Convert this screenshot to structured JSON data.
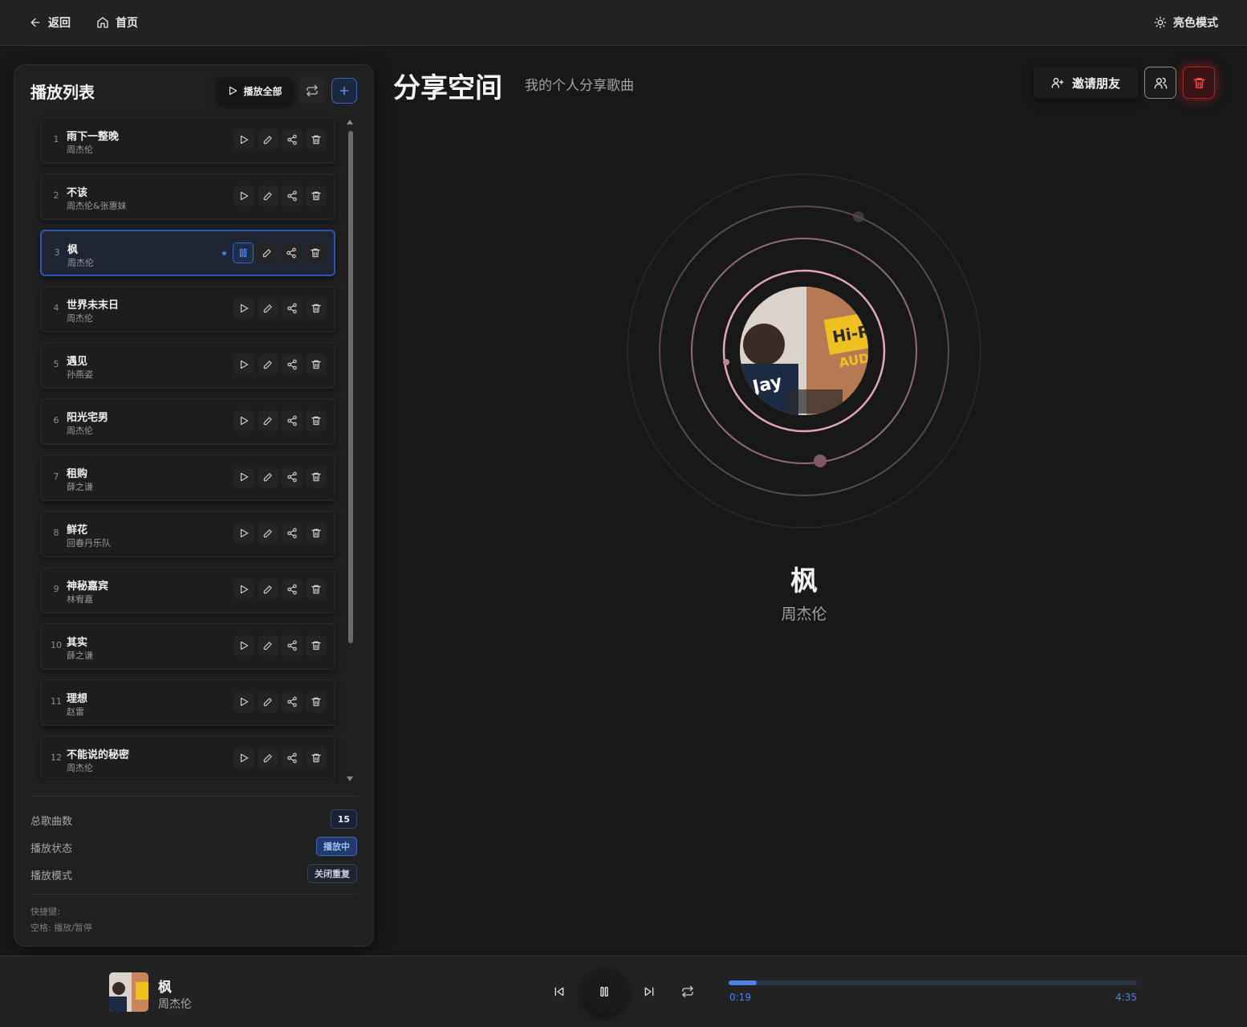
{
  "topbar": {
    "back_label": "返回",
    "home_label": "首页",
    "theme_label": "亮色模式"
  },
  "sidebar": {
    "title": "播放列表",
    "play_all_label": "播放全部",
    "songs": [
      {
        "index": "1",
        "name": "雨下一整晚",
        "artist": "周杰伦"
      },
      {
        "index": "2",
        "name": "不该",
        "artist": "周杰伦&张惠妹"
      },
      {
        "index": "3",
        "name": "枫",
        "artist": "周杰伦",
        "active": true
      },
      {
        "index": "4",
        "name": "世界未末日",
        "artist": "周杰伦"
      },
      {
        "index": "5",
        "name": "遇见",
        "artist": "孙燕姿"
      },
      {
        "index": "6",
        "name": "阳光宅男",
        "artist": "周杰伦"
      },
      {
        "index": "7",
        "name": "租购",
        "artist": "薛之谦"
      },
      {
        "index": "8",
        "name": "鲜花",
        "artist": "回春丹乐队"
      },
      {
        "index": "9",
        "name": "神秘嘉宾",
        "artist": "林宥嘉"
      },
      {
        "index": "10",
        "name": "其实",
        "artist": "薛之谦"
      },
      {
        "index": "11",
        "name": "理想",
        "artist": "赵雷"
      },
      {
        "index": "12",
        "name": "不能说的秘密",
        "artist": "周杰伦"
      }
    ],
    "stats": {
      "total_label": "总歌曲数",
      "total_value": "15",
      "status_label": "播放状态",
      "status_value": "播放中",
      "mode_label": "播放模式",
      "mode_value": "关闭重复"
    },
    "hints": {
      "title": "快捷键:",
      "space": "空格: 播放/暂停"
    }
  },
  "main": {
    "title": "分享空间",
    "subtitle": "我的个人分享歌曲",
    "invite_label": "邀请朋友",
    "now_playing": {
      "title": "枫",
      "artist": "周杰伦"
    }
  },
  "player": {
    "title": "枫",
    "artist": "周杰伦",
    "current_time": "0:19",
    "duration": "4:35",
    "progress": 0.069
  },
  "colors": {
    "accent": "#4f7fe6",
    "danger": "#d03030",
    "ring": "#e3a8b8"
  },
  "icons": {
    "back": "arrow-left-icon",
    "home": "home-icon",
    "theme": "sun-icon",
    "play_all": "play-icon",
    "repeat": "repeat-icon",
    "add": "plus-icon",
    "invite": "user-plus-icon",
    "users": "users-icon",
    "delete": "trash-icon"
  }
}
